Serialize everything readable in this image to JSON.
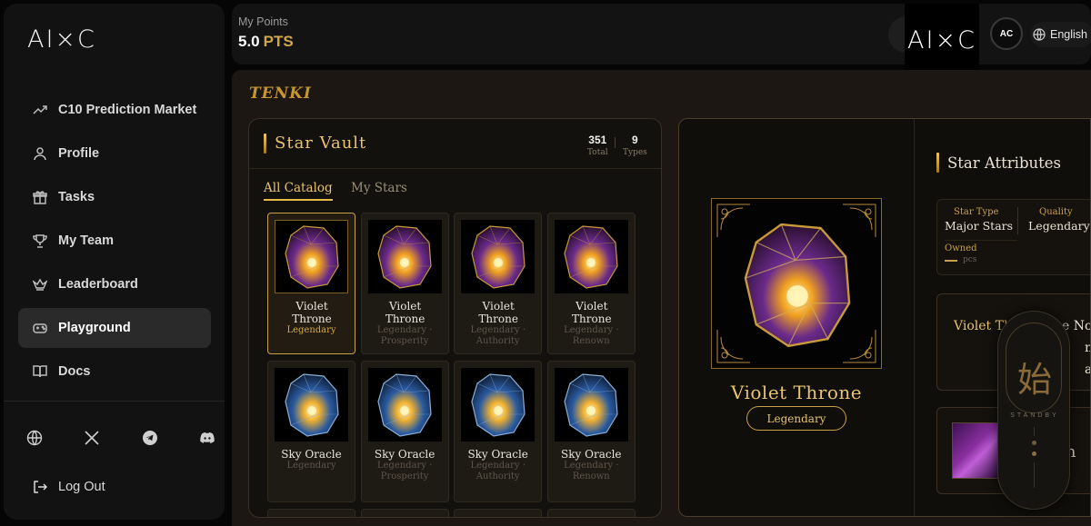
{
  "sidebar": {
    "logo": "AI×C",
    "items": [
      {
        "label": "C10 Prediction Market",
        "icon": "trending-up-icon",
        "active": false
      },
      {
        "label": "Profile",
        "icon": "user-icon",
        "active": false
      },
      {
        "label": "Tasks",
        "icon": "gift-icon",
        "active": false
      },
      {
        "label": "My Team",
        "icon": "trophy-icon",
        "active": false
      },
      {
        "label": "Leaderboard",
        "icon": "crown-icon",
        "active": false
      },
      {
        "label": "Playground",
        "icon": "gamepad-icon",
        "active": true
      },
      {
        "label": "Docs",
        "icon": "book-icon",
        "active": false
      }
    ],
    "socials": [
      "globe-icon",
      "x-icon",
      "telegram-icon",
      "discord-icon"
    ],
    "logout": "Log Out"
  },
  "header": {
    "points_label": "My Points",
    "points_value": "5.0",
    "points_unit": "PTS",
    "logo": "AI×C",
    "avatar": "AC",
    "language": "English"
  },
  "main": {
    "brand": "TENKI",
    "vault": {
      "title": "Star Vault",
      "total": "351",
      "total_label": "Total",
      "types": "9",
      "types_label": "Types",
      "tabs": [
        {
          "label": "All Catalog",
          "active": true
        },
        {
          "label": "My Stars",
          "active": false
        }
      ],
      "cards": [
        {
          "name": "Violet Throne",
          "meta": "Legendary",
          "meta2": "",
          "gem": "violet",
          "selected": true
        },
        {
          "name": "Violet Throne",
          "meta": "Legendary ·",
          "meta2": "Prosperity",
          "gem": "violet",
          "selected": false
        },
        {
          "name": "Violet Throne",
          "meta": "Legendary ·",
          "meta2": "Authority",
          "gem": "violet",
          "selected": false
        },
        {
          "name": "Violet Throne",
          "meta": "Legendary ·",
          "meta2": "Renown",
          "gem": "violet",
          "selected": false
        },
        {
          "name": "Sky Oracle",
          "meta": "Legendary",
          "meta2": "",
          "gem": "sky",
          "selected": false
        },
        {
          "name": "Sky Oracle",
          "meta": "Legendary ·",
          "meta2": "Prosperity",
          "gem": "sky",
          "selected": false
        },
        {
          "name": "Sky Oracle",
          "meta": "Legendary ·",
          "meta2": "Authority",
          "gem": "sky",
          "selected": false
        },
        {
          "name": "Sky Oracle",
          "meta": "Legendary ·",
          "meta2": "Renown",
          "gem": "sky",
          "selected": false
        }
      ]
    },
    "detail": {
      "name": "Violet Throne",
      "badge": "Legendary",
      "attributes_title": "Star Attributes",
      "star_type_label": "Star Type",
      "star_type_value": "Major Stars",
      "quality_label": "Quality",
      "quality_value": "Legendary",
      "owned_label": "Owned",
      "owned_unit": "pcs",
      "desc_highlight": "Violet Th",
      "desc_line1_rest": "e No",
      "desc_line2": "ma",
      "desc_line3": "age",
      "related_name": "on"
    },
    "overlay": {
      "glyph": "始",
      "status": "STANDBY"
    }
  },
  "colors": {
    "accent_gold": "#e8c36e",
    "legendary_gold": "#d9a93d",
    "panel_bg": "#1c1712",
    "sidebar_bg": "#121212"
  }
}
